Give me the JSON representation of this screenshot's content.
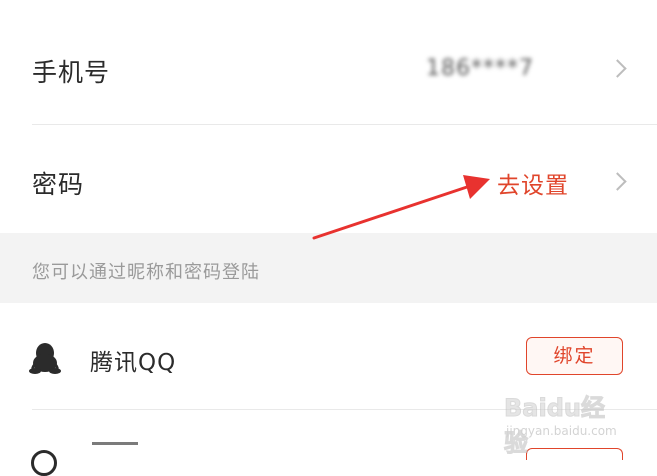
{
  "phone_row": {
    "label": "手机号",
    "value": "186****7"
  },
  "password_row": {
    "label": "密码",
    "action": "去设置"
  },
  "hint": {
    "text": "您可以通过昵称和密码登陆"
  },
  "qq_row": {
    "icon": "qq-penguin-icon",
    "label": "腾讯QQ",
    "button": "绑定"
  },
  "watermark": {
    "main": "Baidu经验",
    "sub": "jingyan.baidu.com"
  },
  "colors": {
    "accent": "#e0452b",
    "arrow": "#e8322f",
    "hint_background": "#f3f3f3",
    "chevron": "#bdbdbd"
  }
}
